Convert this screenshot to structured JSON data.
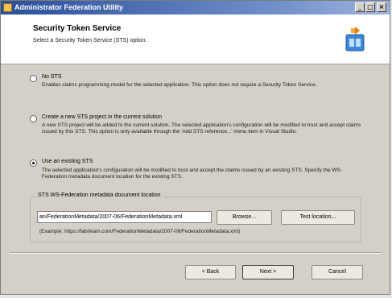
{
  "window": {
    "title": "Administrator Federation Utility",
    "buttons": {
      "minimize": "_",
      "maximize": "□",
      "close": "×"
    }
  },
  "header": {
    "title": "Security Token Service",
    "subtitle": "Select a Security Token Service (STS) option.",
    "icon": "wizard-banner-icon"
  },
  "options": [
    {
      "label": "No STS",
      "description": "Enables claims programming model for the selected application. This option does not require a Security Token Service.",
      "selected": false
    },
    {
      "label": "Create a new STS project in the current solution",
      "description": "A new STS project will be added to the current solution. The selected application's configuration will be modified to trust and accept claims issued by this STS. This option is only available through the 'Add STS reference...' menu item in Visual Studio.",
      "selected": false
    },
    {
      "label": "Use an existing STS",
      "description": "The selected application's configuration will be modified to trust and accept the claims issued by an existing STS. Specify the WS-Federation metadata document location for the existing STS.",
      "selected": true
    }
  ],
  "metadata_group": {
    "label": "STS WS-Federation metadata document location",
    "value": "an/FederationMetadata/2007-06/FederationMetadata.xml",
    "browse_label": "Browse...",
    "test_label": "Test location...",
    "example": "(Example: https://fabrikam.com/FederationMetadata/2007-06/FederationMetadata.xml)"
  },
  "footer": {
    "back_label": "< Back",
    "next_label": "Next >",
    "cancel_label": "Cancel"
  }
}
